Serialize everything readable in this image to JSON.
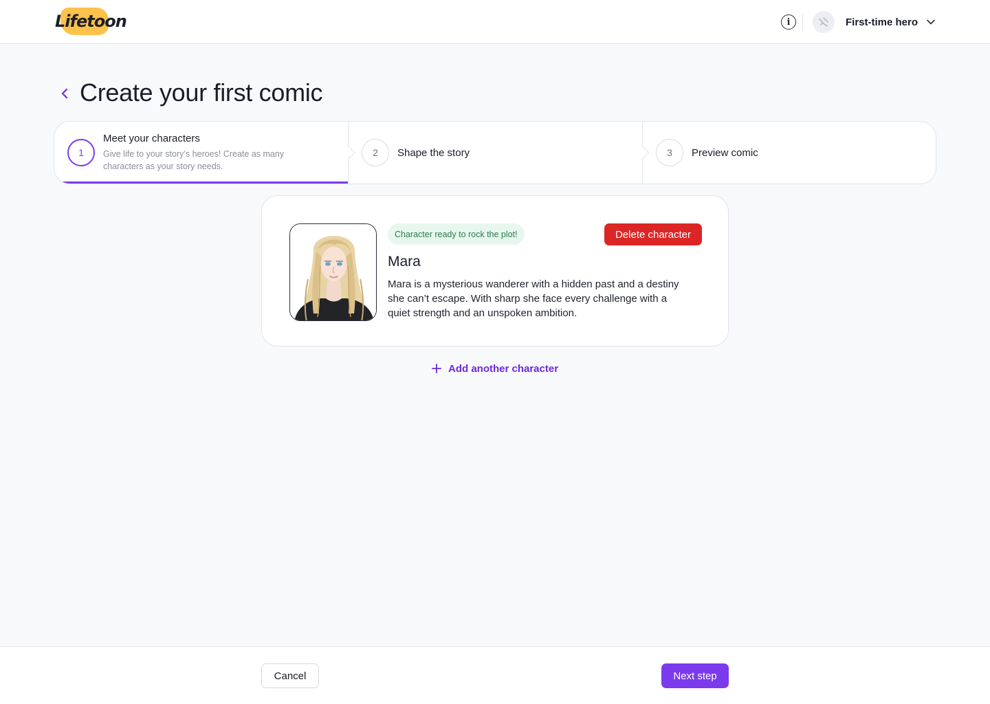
{
  "brand": {
    "logo_text": "Lifetoon",
    "accent": "#7c3aed",
    "logo_bg": "#fdc24a"
  },
  "header": {
    "info_icon": "info-icon",
    "user_name": "First-time hero",
    "avatar_icon": "user-avatar-icon",
    "dropdown_icon": "chevron-down-icon"
  },
  "page": {
    "title": "Create your first comic",
    "back_icon": "chevron-left-icon"
  },
  "stepper": {
    "steps": [
      {
        "number": "1",
        "title": "Meet your characters",
        "description": "Give life to your story’s heroes! Create as many characters as your story needs.",
        "active": true
      },
      {
        "number": "2",
        "title": "Shape the story",
        "active": false
      },
      {
        "number": "3",
        "title": "Preview comic",
        "active": false
      }
    ]
  },
  "character": {
    "status": "Character ready to rock the plot!",
    "delete_label": "Delete character",
    "name": "Mara",
    "description": "Mara is a mysterious wanderer with a hidden past and a destiny she can’t escape. With sharp she face every challenge with a quiet strength and an unspoken ambition."
  },
  "add_character_label": "Add another character",
  "footer": {
    "cancel_label": "Cancel",
    "next_label": "Next step"
  }
}
